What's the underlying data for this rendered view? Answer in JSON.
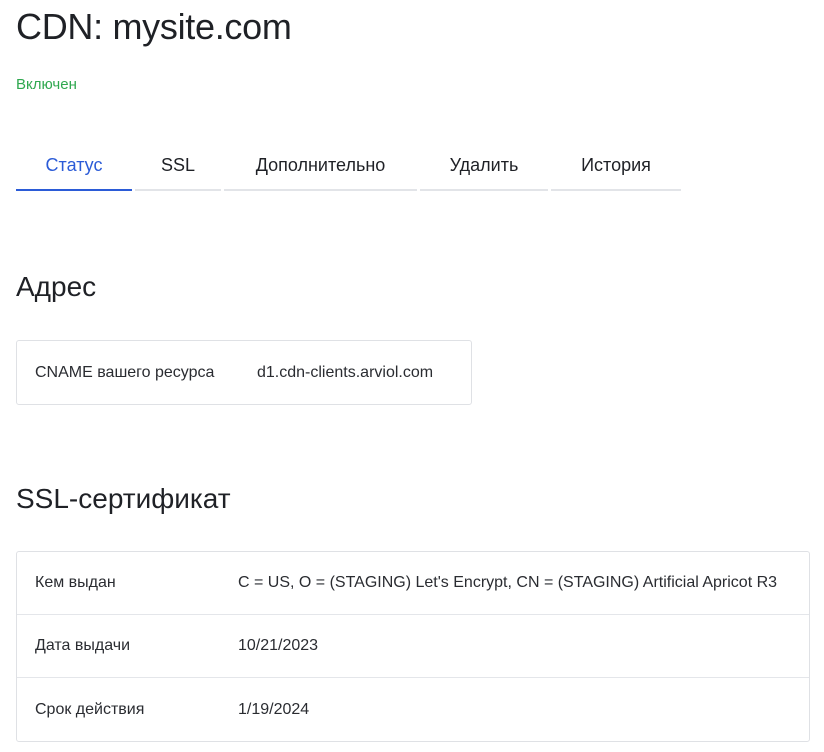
{
  "page": {
    "title": "CDN: mysite.com",
    "status": "Включен"
  },
  "tabs": [
    {
      "label": "Статус",
      "active": true
    },
    {
      "label": "SSL",
      "active": false
    },
    {
      "label": "Дополнительно",
      "active": false
    },
    {
      "label": "Удалить",
      "active": false
    },
    {
      "label": "История",
      "active": false
    }
  ],
  "address": {
    "heading": "Адрес",
    "cname_label": "CNAME вашего ресурса",
    "cname_value": "d1.cdn-clients.arviol.com"
  },
  "ssl": {
    "heading": "SSL-сертификат",
    "rows": [
      {
        "label": "Кем выдан",
        "value": "C = US, O = (STAGING) Let's Encrypt, CN = (STAGING) Artificial Apricot R3"
      },
      {
        "label": "Дата выдачи",
        "value": "10/21/2023"
      },
      {
        "label": "Срок действия",
        "value": "1/19/2024"
      }
    ]
  },
  "colors": {
    "status_green": "#2fa84f",
    "tab_active_blue": "#2b5bd7",
    "border_gray": "#dfe1e5"
  }
}
